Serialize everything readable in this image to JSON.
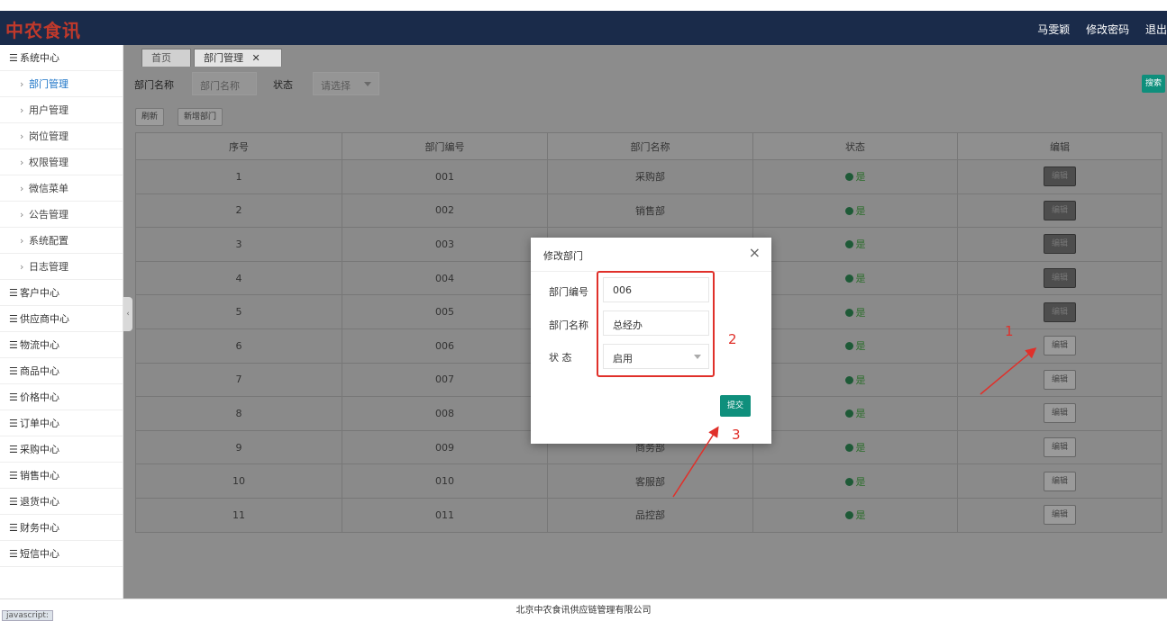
{
  "header": {
    "logo": "中农食讯",
    "user": "马雯颖",
    "change_password": "修改密码",
    "logout": "退出"
  },
  "sidebar": {
    "items": [
      {
        "label": "系统中心",
        "level": "group"
      },
      {
        "label": "部门管理",
        "level": "sub",
        "active": true
      },
      {
        "label": "用户管理",
        "level": "sub"
      },
      {
        "label": "岗位管理",
        "level": "sub"
      },
      {
        "label": "权限管理",
        "level": "sub"
      },
      {
        "label": "微信菜单",
        "level": "sub"
      },
      {
        "label": "公告管理",
        "level": "sub"
      },
      {
        "label": "系统配置",
        "level": "sub"
      },
      {
        "label": "日志管理",
        "level": "sub"
      },
      {
        "label": "客户中心",
        "level": "group"
      },
      {
        "label": "供应商中心",
        "level": "group"
      },
      {
        "label": "物流中心",
        "level": "group"
      },
      {
        "label": "商品中心",
        "level": "group"
      },
      {
        "label": "价格中心",
        "level": "group"
      },
      {
        "label": "订单中心",
        "level": "group"
      },
      {
        "label": "采购中心",
        "level": "group"
      },
      {
        "label": "销售中心",
        "level": "group"
      },
      {
        "label": "退货中心",
        "level": "group"
      },
      {
        "label": "财务中心",
        "level": "group"
      },
      {
        "label": "短信中心",
        "level": "group"
      }
    ]
  },
  "tabs": [
    {
      "label": "首页"
    },
    {
      "label": "部门管理",
      "close": "✕"
    }
  ],
  "filter": {
    "name_label": "部门名称",
    "name_placeholder": "部门名称",
    "status_label": "状态",
    "status_placeholder": "请选择",
    "search_button": "搜索"
  },
  "toolbar": {
    "refresh": "刷新",
    "add": "新增部门"
  },
  "table": {
    "columns": [
      "序号",
      "部门编号",
      "部门名称",
      "状态",
      "编辑"
    ],
    "rows": [
      {
        "index": "1",
        "code": "001",
        "name": "采购部",
        "status": "是",
        "edit": "编辑"
      },
      {
        "index": "2",
        "code": "002",
        "name": "销售部",
        "status": "是",
        "edit": "编辑"
      },
      {
        "index": "3",
        "code": "003",
        "name": "",
        "status": "是",
        "edit": "编辑"
      },
      {
        "index": "4",
        "code": "004",
        "name": "",
        "status": "是",
        "edit": "编辑"
      },
      {
        "index": "5",
        "code": "005",
        "name": "",
        "status": "是",
        "edit": "编辑"
      },
      {
        "index": "6",
        "code": "006",
        "name": "",
        "status": "是",
        "edit": "编辑"
      },
      {
        "index": "7",
        "code": "007",
        "name": "",
        "status": "是",
        "edit": "编辑"
      },
      {
        "index": "8",
        "code": "008",
        "name": "",
        "status": "是",
        "edit": "编辑"
      },
      {
        "index": "9",
        "code": "009",
        "name": "商务部",
        "status": "是",
        "edit": "编辑"
      },
      {
        "index": "10",
        "code": "010",
        "name": "客服部",
        "status": "是",
        "edit": "编辑"
      },
      {
        "index": "11",
        "code": "011",
        "name": "品控部",
        "status": "是",
        "edit": "编辑"
      }
    ]
  },
  "modal": {
    "title": "修改部门",
    "close": "×",
    "code_label": "部门编号",
    "code_value": "006",
    "name_label": "部门名称",
    "name_value": "总经办",
    "status_label": "状 态",
    "status_value": "启用",
    "submit": "提交"
  },
  "annotations": {
    "step1": "1",
    "step2": "2",
    "step3": "3",
    "color": "#e0302a"
  },
  "footer": {
    "company": "北京中农食讯供应链管理有限公司",
    "status_bar": "javascript:"
  },
  "colors": {
    "topbar": "#1a2b4a",
    "primary_button": "#0f8f7c",
    "active_link": "#1a73c7"
  }
}
